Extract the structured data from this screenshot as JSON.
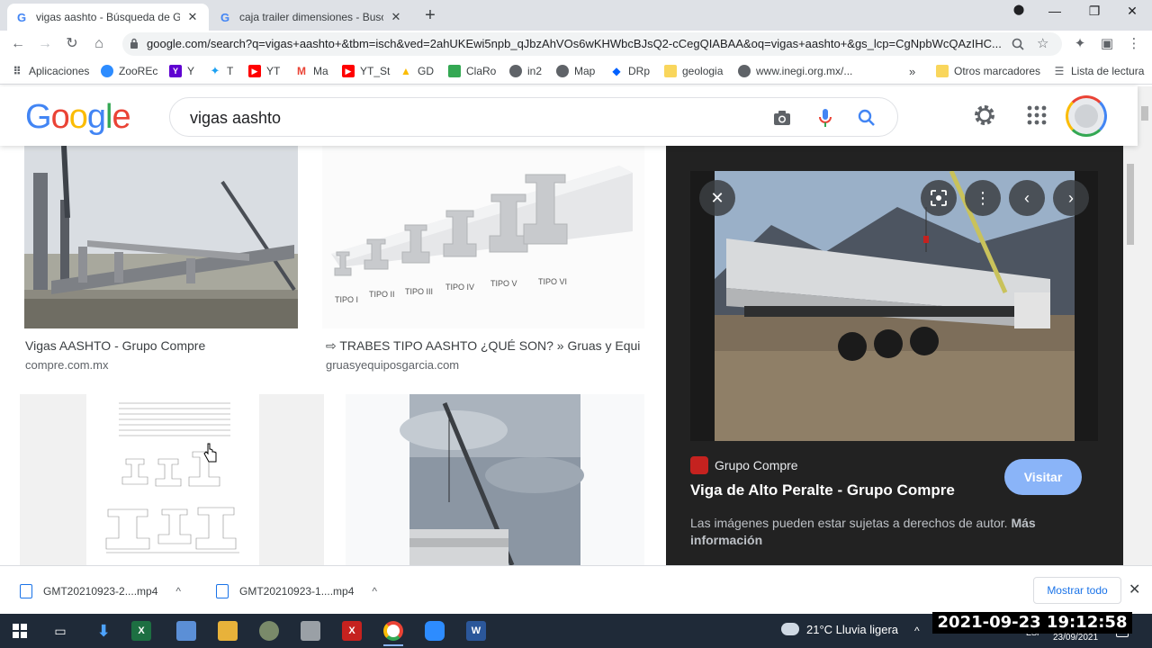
{
  "browser": {
    "tabs": [
      {
        "title": "vigas aashto - Búsqueda de Goo",
        "active": true
      },
      {
        "title": "caja trailer dimensiones - Buscar",
        "active": false
      }
    ],
    "url": "google.com/search?q=vigas+aashto+&tbm=isch&ved=2ahUKEwi5npb_qJbzAhVOs6wKHWbcBJsQ2-cCegQIABAA&oq=vigas+aashto+&gs_lcp=CgNpbWcQAzIHC...",
    "bookmarks": [
      "Aplicaciones",
      "ZooREc",
      "Y",
      "T",
      "YT",
      "Ma",
      "YT_St",
      "GD",
      "ClaRo",
      "in2",
      "Map",
      "DRp",
      "geologia",
      "www.inegi.org.mx/...",
      "Otros marcadores",
      "Lista de lectura"
    ],
    "bookmark_more": "»"
  },
  "search": {
    "logo": "Google",
    "query": "vigas aashto"
  },
  "results": [
    {
      "caption": "Vigas AASHTO - Grupo Compre",
      "source": "compre.com.mx"
    },
    {
      "caption": "⇨ TRABES TIPO AASHTO ¿QUÉ SON? » Gruas y Equi...",
      "source": "gruasyequiposgarcia.com"
    }
  ],
  "beam_types": [
    "TIPO I",
    "TIPO II",
    "TIPO III",
    "TIPO IV",
    "TIPO V",
    "TIPO VI"
  ],
  "preview": {
    "site": "Grupo Compre",
    "title": "Viga de Alto Peralte - Grupo Compre",
    "visit_label": "Visitar",
    "note": "Las imágenes pueden estar sujetas a derechos de autor.",
    "note_link": "Más información"
  },
  "downloads": {
    "items": [
      "GMT20210923-2....mp4",
      "GMT20210923-1....mp4"
    ],
    "show_all": "Mostrar todo"
  },
  "taskbar": {
    "weather": "21°C  Lluvia ligera",
    "lang": "ESP",
    "date": "23/09/2021",
    "timestamp": "2021-09-23 19:12:58"
  },
  "colors": {
    "google_blue": "#4285f4",
    "google_red": "#ea4335",
    "google_yellow": "#fbbc05",
    "google_green": "#34a853",
    "visit_button": "#8ab4f8"
  }
}
